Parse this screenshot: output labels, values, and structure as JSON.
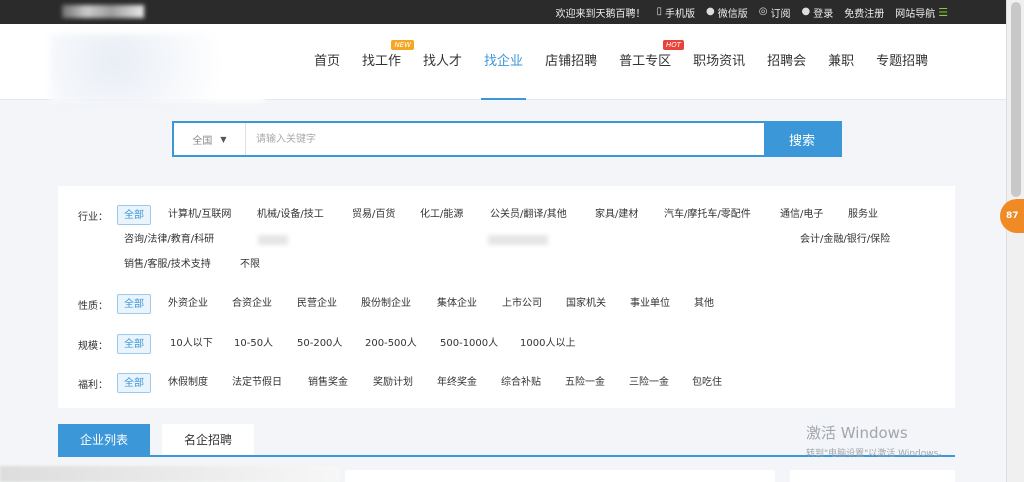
{
  "topbar": {
    "welcome": "欢迎来到天鹅百聘！",
    "mobile": "手机版",
    "wechat": "微信版",
    "subscribe": "订阅",
    "login": "登录",
    "register": "免费注册",
    "sitenav": "网站导航"
  },
  "nav": {
    "items": [
      {
        "label": "首页"
      },
      {
        "label": "找工作",
        "badge": "NEW"
      },
      {
        "label": "找人才"
      },
      {
        "label": "找企业"
      },
      {
        "label": "店铺招聘"
      },
      {
        "label": "普工专区",
        "badge": "HOT"
      },
      {
        "label": "职场资讯"
      },
      {
        "label": "招聘会"
      },
      {
        "label": "兼职"
      },
      {
        "label": "专题招聘"
      }
    ],
    "active": "找企业"
  },
  "search": {
    "region": "全国",
    "placeholder": "请输入关键字",
    "button": "搜索"
  },
  "filters": {
    "industry": {
      "label": "行业：",
      "options": [
        "全部",
        "计算机/互联网",
        "机械/设备/技工",
        "贸易/百货",
        "化工/能源",
        "公关员/翻译/其他",
        "家具/建材",
        "汽车/摩托车/零配件",
        "通信/电子",
        "服务业",
        "咨询/法律/教育/科研",
        "会计/金融/银行/保险",
        "销售/客服/技术支持",
        "不限"
      ]
    },
    "nature": {
      "label": "性质：",
      "options": [
        "全部",
        "外资企业",
        "合资企业",
        "民营企业",
        "股份制企业",
        "集体企业",
        "上市公司",
        "国家机关",
        "事业单位",
        "其他"
      ]
    },
    "scale": {
      "label": "规模：",
      "options": [
        "全部",
        "10人以下",
        "10-50人",
        "50-200人",
        "200-500人",
        "500-1000人",
        "1000人以上"
      ]
    },
    "welfare": {
      "label": "福利：",
      "options": [
        "全部",
        "休假制度",
        "法定节假日",
        "销售奖金",
        "奖励计划",
        "年终奖金",
        "综合补贴",
        "五险一金",
        "三险一金",
        "包吃住"
      ]
    }
  },
  "tabs": [
    "企业列表",
    "名企招聘"
  ],
  "side_badge": "87",
  "watermark": {
    "line1": "激活 Windows",
    "line2": "转到\"电脑设置\"以激活 Windows。"
  }
}
